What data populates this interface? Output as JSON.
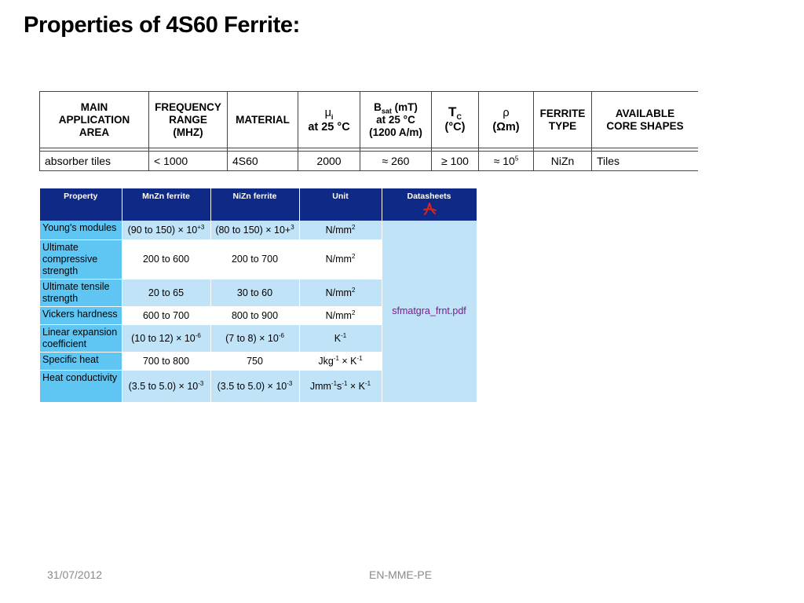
{
  "slide": {
    "title": "Properties of 4S60 Ferrite:",
    "footer_date": "31/07/2012",
    "footer_center": "EN-MME-PE"
  },
  "table1": {
    "headers": {
      "main_application_area": [
        "MAIN",
        "APPLICATION",
        "AREA"
      ],
      "frequency_range": [
        "FREQUENCY",
        "RANGE",
        "(MHZ)"
      ],
      "material": "MATERIAL",
      "mu_i": {
        "symbol": "μ",
        "subscript": "i",
        "line2": "at 25 °C"
      },
      "bsat": {
        "symbol": "B",
        "subscript": "sat",
        "unit": "(mT)",
        "line2": "at 25 °C",
        "line3": "(1200 A/m)"
      },
      "tc": {
        "symbol": "T",
        "subscript": "C",
        "line2": "(°C)"
      },
      "rho": {
        "symbol": "ρ",
        "line2": "(Ωm)"
      },
      "ferrite_type": [
        "FERRITE",
        "TYPE"
      ],
      "core_shapes": [
        "AVAILABLE",
        "CORE SHAPES"
      ]
    },
    "row": {
      "application": "absorber tiles",
      "frequency": "< 1000",
      "material": "4S60",
      "mu_i": "2000",
      "bsat": "≈ 260",
      "tc": "≥ 100",
      "rho_prefix": "≈ 10",
      "rho_exp": "5",
      "ferrite_type": "NiZn",
      "core_shapes": "Tiles"
    }
  },
  "table2": {
    "headers": {
      "property": "Property",
      "mnzn": "MnZn ferrite",
      "nizn": "NiZn ferrite",
      "unit": "Unit",
      "datasheets": "Datasheets"
    },
    "datasheet_link": "sfmatgra_frnt.pdf",
    "rows": [
      {
        "property": "Young's modules",
        "mnzn": "(90 to 150) ×  10",
        "mnzn_exp": "+3",
        "nizn": "(80 to 150) ×  10+",
        "nizn_exp": "3",
        "unit": "N/mm",
        "unit_exp": "2"
      },
      {
        "property": "Ultimate compressive strength",
        "mnzn": "200 to 600",
        "nizn": "200 to 700",
        "unit": "N/mm",
        "unit_exp": "2"
      },
      {
        "property": "Ultimate tensile strength",
        "mnzn": "20 to 65",
        "nizn": "30 to 60",
        "unit": "N/mm",
        "unit_exp": "2"
      },
      {
        "property": "Vickers hardness",
        "mnzn": "600 to 700",
        "nizn": "800 to 900",
        "unit": "N/mm",
        "unit_exp": "2"
      },
      {
        "property": "Linear expansion coefficient",
        "mnzn": "(10 to 12) ×  10",
        "mnzn_exp": "-6",
        "nizn": "(7 to 8) ×  10",
        "nizn_exp": "-6",
        "unit": "K",
        "unit_exp": "-1"
      },
      {
        "property": "Specific heat",
        "mnzn": "700 to 800",
        "nizn": "750",
        "unit_a": "Jkg",
        "unit_a_exp": "-1",
        "unit_b": " ×  K",
        "unit_b_exp": "-1"
      },
      {
        "property": "Heat conductivity",
        "mnzn": "(3.5 to 5.0) ×  10",
        "mnzn_exp": "-3",
        "nizn": "(3.5 to 5.0) ×  10",
        "nizn_exp": "-3",
        "unit_a": "Jmm",
        "unit_a_exp": "-1",
        "unit_b": "s",
        "unit_b_exp": "-1",
        "unit_c": " ×  K",
        "unit_c_exp": "-1"
      }
    ]
  }
}
